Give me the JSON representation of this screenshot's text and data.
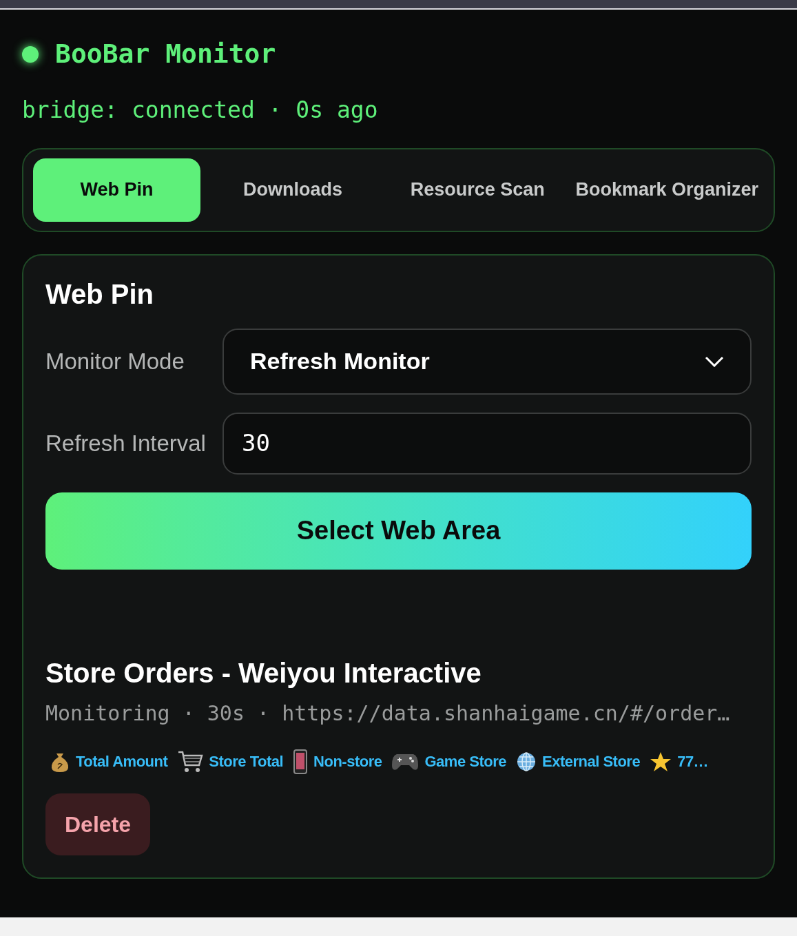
{
  "header": {
    "title": "BooBar Monitor",
    "status": "bridge: connected · 0s ago",
    "online": true
  },
  "tabs": [
    {
      "label": "Web Pin",
      "selected": true
    },
    {
      "label": "Downloads",
      "selected": false
    },
    {
      "label": "Resource Scan",
      "selected": false
    },
    {
      "label": "Bookmark Organizer",
      "selected": false
    }
  ],
  "panel": {
    "title": "Web Pin",
    "fields": [
      {
        "kind": "select",
        "label": "Monitor Mode",
        "value": "Refresh Monitor"
      },
      {
        "kind": "input",
        "label": "Refresh Interval",
        "value": "30"
      }
    ],
    "action": "Select Web Area",
    "monitor": {
      "title": "Store Orders - Weiyou Interactive",
      "meta": "Monitoring · 30s · https://data.shanhaigame.cn/#/order…",
      "metrics": [
        "Total Amount",
        "Store Total",
        "Non-store",
        "Game Store",
        "External Store",
        "77…"
      ],
      "delete": "Delete"
    }
  }
}
